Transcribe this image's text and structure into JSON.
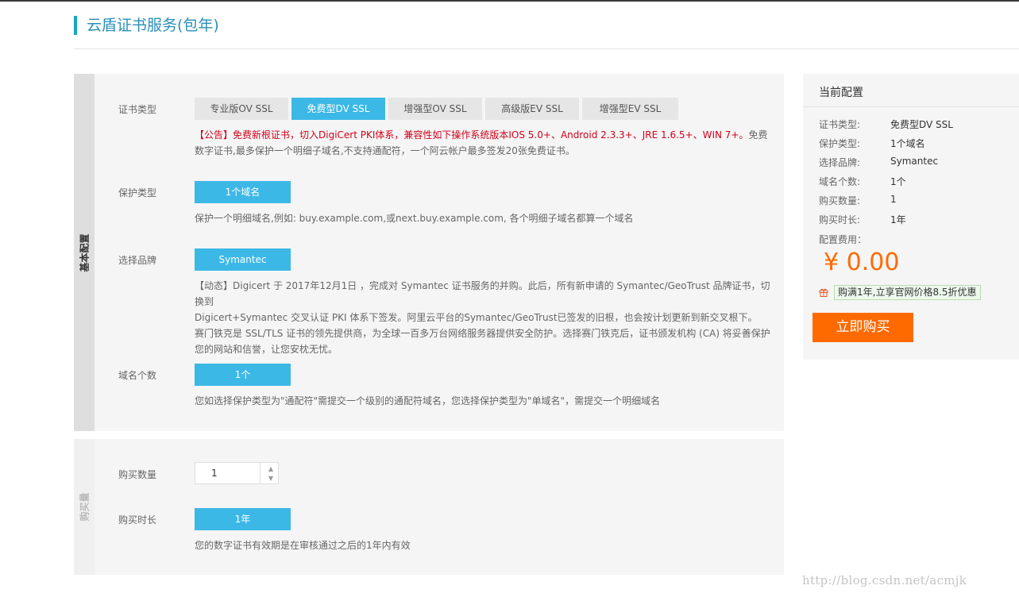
{
  "header": {
    "title": "云盾证书服务(包年)"
  },
  "basic_section": {
    "side_label": "基本配置",
    "cert_type": {
      "label": "证书类型",
      "options": [
        "专业版OV SSL",
        "免费型DV SSL",
        "增强型OV SSL",
        "高级版EV SSL",
        "增强型EV SSL"
      ],
      "selected": "免费型DV SSL",
      "notice_red": "【公告】免费新根证书，切入DigiCert PKI体系，兼容性如下操作系统版本IOS 5.0+、Android 2.3.3+、JRE 1.6.5+、WIN 7+。",
      "notice_gray": "免费数字证书,最多保护一个明细子域名,不支持通配符，一个阿云帐户最多签发20张免费证书。"
    },
    "protect_type": {
      "label": "保护类型",
      "option": "1个域名",
      "desc": "保护一个明细域名,例如: buy.example.com,或next.buy.example.com, 各个明细子域名都算一个域名"
    },
    "brand": {
      "label": "选择品牌",
      "option": "Symantec",
      "desc_line1": "【动态】Digicert 于 2017年12月1日 ，完成对 Symantec 证书服务的并购。此后，所有新申请的 Symantec/GeoTrust 品牌证书，切换到",
      "desc_line2": "Digicert+Symantec 交叉认证 PKI 体系下签发。阿里云平台的Symantec/GeoTrust已签发的旧根，也会按计划更新到新交叉根下。",
      "desc_line3": "赛门铁克是 SSL/TLS 证书的领先提供商，为全球一百多万台网络服务器提供安全防护。选择赛门铁克后，证书颁发机构 (CA) 将妥善保护",
      "desc_line4": "您的网站和信誉，让您安枕无忧。"
    },
    "domain_count": {
      "label": "域名个数",
      "option": "1个",
      "desc": "您如选择保护类型为\"通配符\"需提交一个级别的通配符域名，您选择保护类型为\"单域名\"，需提交一个明细域名"
    }
  },
  "buy_section": {
    "side_label": "购买量",
    "quantity": {
      "label": "购买数量",
      "value": "1"
    },
    "duration": {
      "label": "购买时长",
      "option": "1年",
      "desc": "您的数字证书有效期是在审核通过之后的1年内有效"
    }
  },
  "config_panel": {
    "title": "当前配置",
    "rows": [
      {
        "key": "证书类型:",
        "value": "免费型DV SSL"
      },
      {
        "key": "保护类型:",
        "value": "1个域名"
      },
      {
        "key": "选择品牌:",
        "value": "Symantec"
      },
      {
        "key": "域名个数:",
        "value": "1个"
      },
      {
        "key": "购买数量:",
        "value": "1"
      },
      {
        "key": "购买时长:",
        "value": "1年"
      }
    ],
    "fee_label": "配置费用：",
    "price": "¥ 0.00",
    "promo": "购满1年,立享官网价格8.5折优惠",
    "buy_button": "立即购买"
  },
  "watermark": "http://blog.csdn.net/acmjk",
  "colors": {
    "accent_blue": "#3cb8e6",
    "title_blue": "#2a8fb8",
    "orange": "#ff6a00",
    "notice_red": "#d0021b"
  }
}
